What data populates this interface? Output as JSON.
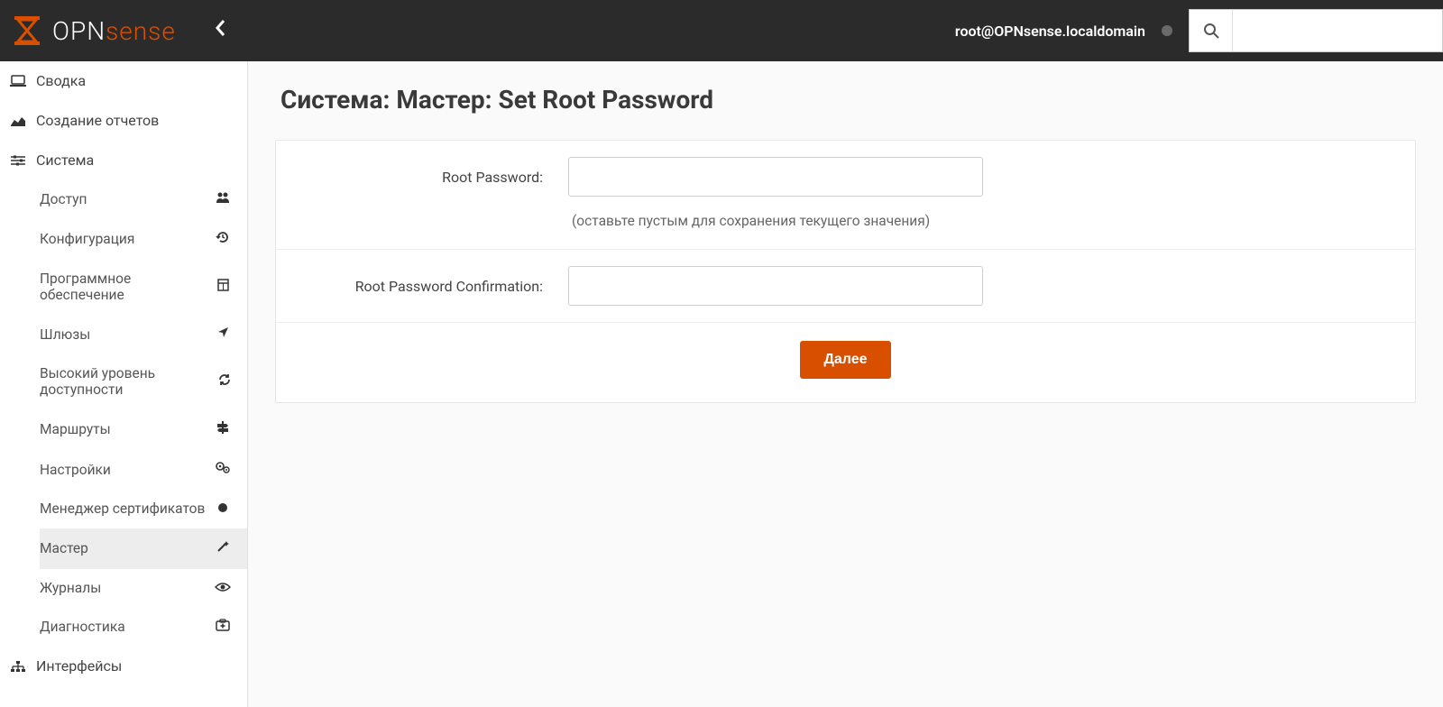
{
  "header": {
    "brand_left": "OPN",
    "brand_right": "sense",
    "user_host": "root@OPNsense.localdomain",
    "search_placeholder": ""
  },
  "sidebar": {
    "top": [
      {
        "label": "Сводка"
      },
      {
        "label": "Создание отчетов"
      }
    ],
    "system_label": "Система",
    "system_items": [
      {
        "label": "Доступ",
        "icon": "users-icon"
      },
      {
        "label": "Конфигурация",
        "icon": "history-icon"
      },
      {
        "label": "Программное обеспечение",
        "icon": "package-icon"
      },
      {
        "label": "Шлюзы",
        "icon": "location-arrow-icon"
      },
      {
        "label": "Высокий уровень доступности",
        "icon": "refresh-icon"
      },
      {
        "label": "Маршруты",
        "icon": "signpost-icon"
      },
      {
        "label": "Настройки",
        "icon": "cogs-icon"
      },
      {
        "label": "Менеджер сертификатов",
        "icon": "circle-icon"
      },
      {
        "label": "Мастер",
        "icon": "wand-icon",
        "active": true
      },
      {
        "label": "Журналы",
        "icon": "eye-icon"
      },
      {
        "label": "Диагностика",
        "icon": "medkit-icon"
      }
    ],
    "interfaces_label": "Интерфейсы"
  },
  "page": {
    "title": "Система: Мастер: Set Root Password",
    "root_password_label": "Root Password:",
    "root_password_help": "(оставьте пустым для сохранения текущего значения)",
    "root_password_confirm_label": "Root Password Confirmation:",
    "next_button": "Далее"
  },
  "colors": {
    "accent": "#d94f00",
    "header_bg": "#2b2b2b"
  }
}
